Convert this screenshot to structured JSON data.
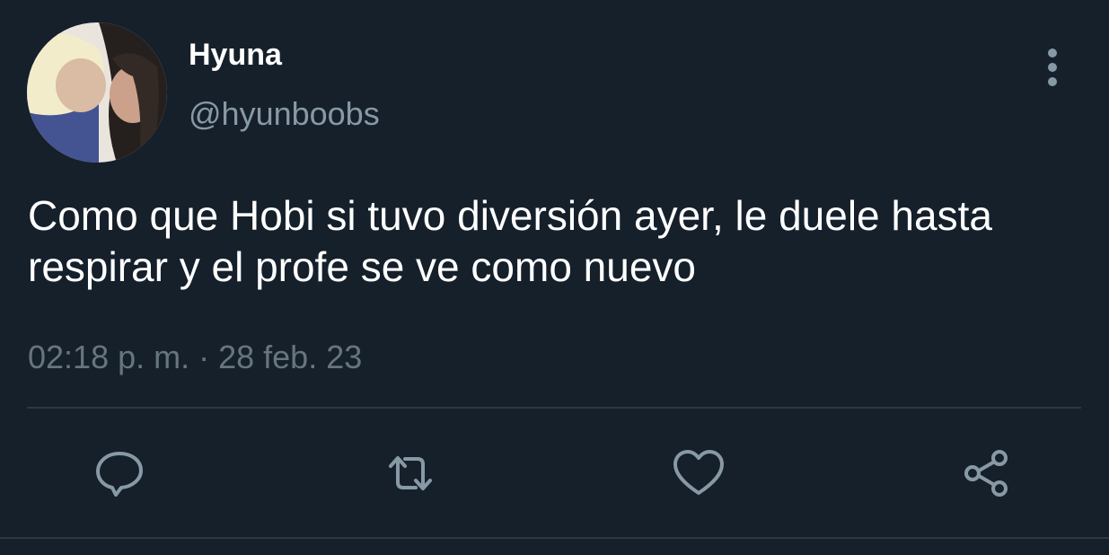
{
  "tweet": {
    "author": {
      "display_name": "Hyuna",
      "handle": "@hyunboobs"
    },
    "text": "Como que Hobi si tuvo diversión ayer, le duele hasta respirar y el profe se ve como nuevo",
    "timestamp": "02:18 p. m. · 28 feb. 23"
  },
  "actions": [
    {
      "icon": "reply-icon"
    },
    {
      "icon": "retweet-icon"
    },
    {
      "icon": "heart-icon"
    },
    {
      "icon": "share-icon"
    }
  ],
  "colors": {
    "background": "#15202b",
    "primary_text": "#ffffff",
    "secondary_text": "#8899a6",
    "icon": "#8899a6",
    "divider": "#2b3945"
  }
}
